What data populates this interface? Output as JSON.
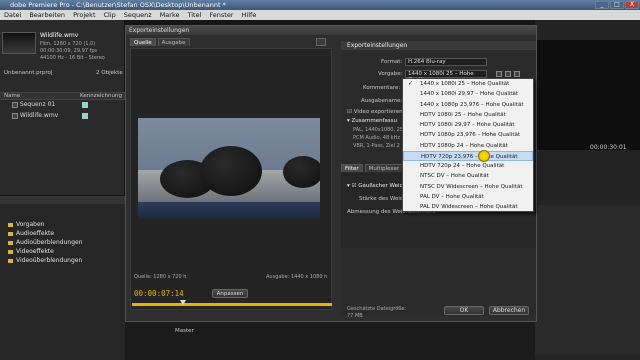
{
  "window": {
    "title": "dobe Premiere Pro - C:\\Benutzer\\Stefan OSX\\Desktop\\Unbenannt *",
    "minimize": "_",
    "maximize": "□",
    "close": "X"
  },
  "menu": [
    "Datei",
    "Bearbeiten",
    "Projekt",
    "Clip",
    "Sequenz",
    "Marke",
    "Titel",
    "Fenster",
    "Hilfe"
  ],
  "project": {
    "clip_name": "Wildlife.wmv",
    "clip_info1": "Film, 1280 x 720 (1,0)",
    "clip_info2": "00:00:30:09, 29,97 fps",
    "clip_info3": "44100 Hz - 16 Bit - Stereo",
    "project_name": "Unbenannt.prproj",
    "objects": "2 Objekte",
    "col_name": "Name",
    "col_label": "Kennzeichnung",
    "items": [
      "Sequenz 01",
      "Wildlife.wmv"
    ]
  },
  "effects": {
    "items": [
      "Vorgaben",
      "Audioeffekte",
      "Audioüberblendungen",
      "Videoeffekte",
      "Videoüberblendungen"
    ]
  },
  "dialog": {
    "title": "Exporteinstellungen",
    "tabs": [
      "Quelle",
      "Ausgabe"
    ],
    "source_info": "Quelle: 1280 x 720 h",
    "output_info": "Ausgabe: 1440 x 1080 h",
    "timecode": "00:00:07:14",
    "fit": "Anpassen",
    "section_title": "Exporteinstellungen",
    "format_label": "Format:",
    "format_value": "H.264 Blu-ray",
    "preset_label": "Vorgabe:",
    "preset_value": "1440 x 1080i 25 – Hohe Quali",
    "comments_label": "Kommentare:",
    "output_label": "Ausgabename:",
    "video_export": "Video exportieren",
    "summary_title": "Zusammenfassu",
    "summary1": "PAL, 1440x1080, 25",
    "summary2": "PCM Audio, 48 kHz",
    "summary3": "VBR, 1-Pass, Ziel 2",
    "subtabs": [
      "Filter",
      "Multiplexer"
    ],
    "gauss": "Gaußscher Weic",
    "strength": "Stärke des Weichz",
    "dimension": "Abmessung des Weichzeichners",
    "filesize_label": "Geschätzte Dateigröße:",
    "filesize_value": "77 MB",
    "ok": "OK",
    "cancel": "Abbrechen"
  },
  "dropdown": {
    "items": [
      "1440 x 1080i 25 – Hohe Qualität",
      "1440 x 1080i 29,97 – Hohe Qualität",
      "1440 x 1080p 23,976 – Hohe Qualität",
      "HDTV 1080i 25 – Hohe Qualität",
      "HDTV 1080i 29,97 – Hohe Qualität",
      "HDTV 1080p 23,976 – Hohe Qualität",
      "HDTV 1080p 24 – Hohe Qualität",
      "HDTV 720p 23,976 – Hohe Qualität",
      "HDTV 720p 24 – Hohe Qualität",
      "NTSC DV – Hohe Qualität",
      "NTSC DV Widescreen – Hohe Qualität",
      "PAL DV – Hohe Qualität",
      "PAL DV Widescreen – Hohe Qualität"
    ],
    "checked": 0,
    "highlighted": 7
  },
  "program": {
    "timecode": "00:00:30:01"
  },
  "timeline": {
    "master": "Master"
  },
  "colors": {
    "accent_yellow": "#e8b400",
    "highlight": "#c7dcf3"
  }
}
